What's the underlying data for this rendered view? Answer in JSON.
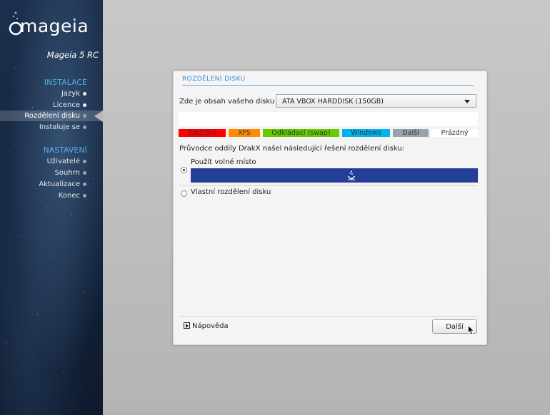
{
  "sidebar": {
    "logo_text": "mageia",
    "version": "Mageia 5 RC",
    "sections": [
      {
        "title": "INSTALACE",
        "steps": [
          {
            "label": "Jazyk",
            "state": "done"
          },
          {
            "label": "Licence",
            "state": "done"
          },
          {
            "label": "Rozdělení disku",
            "state": "current"
          },
          {
            "label": "Instaluje se",
            "state": "pending"
          }
        ]
      },
      {
        "title": "NASTAVENÍ",
        "steps": [
          {
            "label": "Uživatelé",
            "state": "pending"
          },
          {
            "label": "Souhrn",
            "state": "pending"
          },
          {
            "label": "Aktualizace",
            "state": "pending"
          },
          {
            "label": "Konec",
            "state": "pending"
          }
        ]
      }
    ]
  },
  "dialog": {
    "title": "ROZDĚLENÍ DISKU",
    "disk_label": "Zde je obsah vašeho disku",
    "disk_value": "ATA VBOX HARDDISK (150GB)",
    "legend": [
      {
        "label": "Ext2/3/4",
        "color": "#ff0000"
      },
      {
        "label": "XFS",
        "color": "#ff8c00"
      },
      {
        "label": "Odkládací (swap)",
        "color": "#66cc00"
      },
      {
        "label": "Windows",
        "color": "#00b2f0"
      },
      {
        "label": "Další",
        "color": "#9aa2ad"
      },
      {
        "label": "Prázdný",
        "color": "#ffffff"
      }
    ],
    "hint": "Průvodce oddíly DrakX našel následující řešení rozdělení disku:",
    "option1_label": "Použít volné místo",
    "option2_label": "Vlastní rozdělení disku",
    "option_bar_color": "#233f98",
    "help_label": "Nápověda",
    "next_label": "Další"
  }
}
